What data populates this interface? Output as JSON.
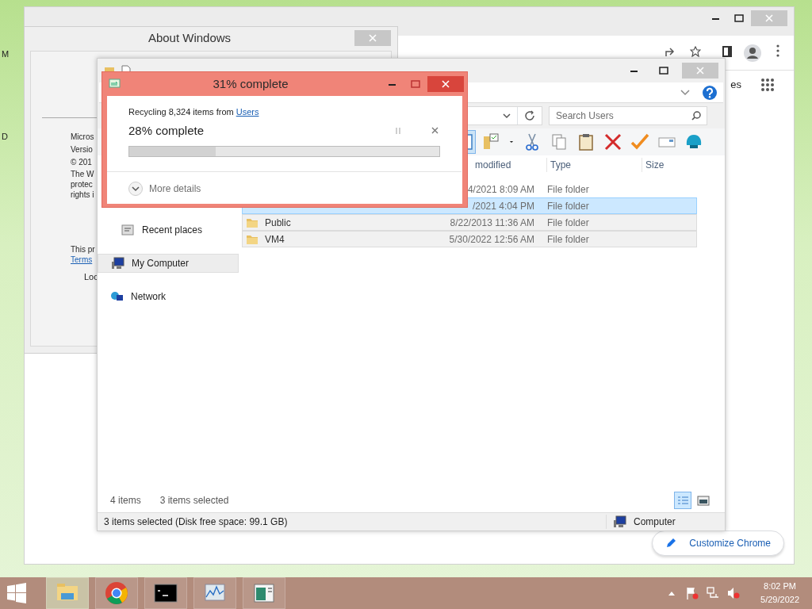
{
  "desktop": {
    "icon_labels": [
      "M",
      "D"
    ]
  },
  "chrome": {
    "partial_link": "es",
    "customize_button": "Customize Chrome"
  },
  "about_windows": {
    "title": "About Windows",
    "lines": [
      "Micros",
      "Versio",
      "© 201"
    ],
    "paragraph_lines": [
      "The W",
      "protec",
      "rights i"
    ],
    "license": "This pr",
    "terms_link": "Terms",
    "footer": "Loc"
  },
  "explorer": {
    "search": {
      "placeholder": "Search Users"
    },
    "columns": [
      "modified",
      "Type",
      "Size"
    ],
    "rows": [
      {
        "date": "4/2021 8:09 AM",
        "type": "File folder",
        "selected": false,
        "focused": false
      },
      {
        "date": "/2021 4:04 PM",
        "type": "File folder",
        "selected": true,
        "focused": true
      },
      {
        "name": "Public",
        "date": "8/22/2013 11:36 AM",
        "type": "File folder",
        "selected": true,
        "focused": false
      },
      {
        "name": "VM4",
        "date": "5/30/2022 12:56 AM",
        "type": "File folder",
        "selected": true,
        "focused": false
      }
    ],
    "nav": [
      {
        "kind": "recent",
        "label": "Recent places",
        "selected": false
      },
      {
        "kind": "computer",
        "label": "My Computer",
        "selected": true
      },
      {
        "kind": "network",
        "label": "Network",
        "selected": false
      }
    ],
    "item_count": "4 items",
    "selection_count": "3 items selected",
    "views": [
      {
        "kind": "details",
        "selected": true
      },
      {
        "kind": "preview",
        "selected": false
      }
    ],
    "status": "3 items selected (Disk free space: 99.1 GB)",
    "location": "Computer"
  },
  "progress_dialog": {
    "title": "31% complete",
    "message": "Recycling 8,324 items from",
    "source_link": "Users",
    "progress": "28% complete",
    "level": 0.28,
    "details_toggle": "More details",
    "expanded": false
  },
  "taskbar": {
    "apps": [
      {
        "kind": "explorer",
        "active": true
      },
      {
        "kind": "chrome",
        "active": false
      },
      {
        "kind": "console",
        "active": false
      },
      {
        "kind": "monitor",
        "active": false
      },
      {
        "kind": "document",
        "active": false
      }
    ],
    "time": "8:02 PM",
    "date": "5/29/2022"
  }
}
